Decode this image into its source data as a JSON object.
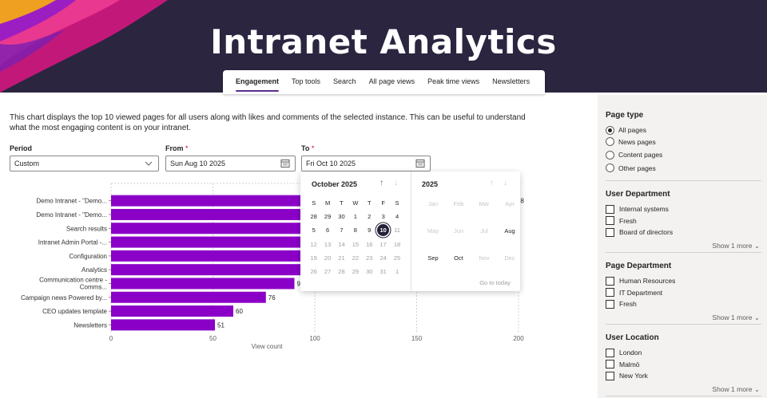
{
  "header": {
    "title": "Intranet Analytics"
  },
  "tabs": [
    {
      "label": "Engagement",
      "active": true
    },
    {
      "label": "Top tools"
    },
    {
      "label": "Search"
    },
    {
      "label": "All page views"
    },
    {
      "label": "Peak time views"
    },
    {
      "label": "Newsletters"
    }
  ],
  "description": "This chart displays the top 10 viewed pages for all users along with likes and comments of the selected instance. This can be useful to understand what the most engaging content is on your intranet.",
  "filters": {
    "period": {
      "label": "Period",
      "value": "Custom"
    },
    "from": {
      "label": "From",
      "required_mark": "*",
      "value": "Sun Aug 10 2025"
    },
    "to": {
      "label": "To",
      "required_mark": "*",
      "value": "Fri Oct 10 2025"
    }
  },
  "chart_data": {
    "type": "bar",
    "orientation": "horizontal",
    "categories": [
      "Demo Intranet - \"Demo...",
      "Demo Intranet - \"Demo...",
      "Search results",
      "Intranet Admin Portal -...",
      "Configuration",
      "Analytics",
      "Communication centre - Comms...",
      "Campaign news Powered by...",
      "CEO updates template",
      "Newsletters"
    ],
    "values": [
      198,
      198,
      178,
      168,
      160,
      132,
      90,
      76,
      60,
      51
    ],
    "value_labels": [
      "98",
      null,
      null,
      null,
      null,
      null,
      "9",
      "76",
      "60",
      "51"
    ],
    "xlabel": "View count",
    "xlim": [
      0,
      200
    ],
    "xticks": [
      "0",
      "50",
      "100",
      "150",
      "200"
    ],
    "bar_color": "#8b00c7",
    "grid": "vertical-dashed"
  },
  "datepicker": {
    "month_title": "October 2025",
    "year_title": "2025",
    "weekdays": [
      "S",
      "M",
      "T",
      "W",
      "T",
      "F",
      "S"
    ],
    "days": [
      [
        "28",
        "29",
        "30",
        "1",
        "2",
        "3",
        "4"
      ],
      [
        "5",
        "6",
        "7",
        "8",
        "9",
        "10",
        "11"
      ],
      [
        "12",
        "13",
        "14",
        "15",
        "16",
        "17",
        "18"
      ],
      [
        "19",
        "20",
        "21",
        "22",
        "23",
        "24",
        "25"
      ],
      [
        "26",
        "27",
        "28",
        "29",
        "30",
        "31",
        "1"
      ]
    ],
    "selected_day": "10",
    "months": [
      "Jan",
      "Feb",
      "Mar",
      "Apr",
      "May",
      "Jun",
      "Jul",
      "Aug",
      "Sep",
      "Oct",
      "Nov",
      "Dec"
    ],
    "go_to_today": "Go to today"
  },
  "pane": {
    "page_type": {
      "title": "Page type",
      "options": [
        "All pages",
        "News pages",
        "Content pages",
        "Other pages"
      ],
      "selected": "All pages"
    },
    "user_department": {
      "title": "User Department",
      "options": [
        "Internal systems",
        "Fresh",
        "Board of directors"
      ],
      "show_more": "Show 1 more"
    },
    "page_department": {
      "title": "Page Department",
      "options": [
        "Human Resources",
        "IT Department",
        "Fresh"
      ],
      "show_more": "Show 1 more"
    },
    "user_location": {
      "title": "User Location",
      "options": [
        "London",
        "Malmö",
        "New York"
      ],
      "show_more": "Show 1 more"
    }
  },
  "colors": {
    "banner": "#2b2540",
    "accent": "#5c2d91",
    "bar": "#8b00c7",
    "pane": "#f3f2f1"
  }
}
